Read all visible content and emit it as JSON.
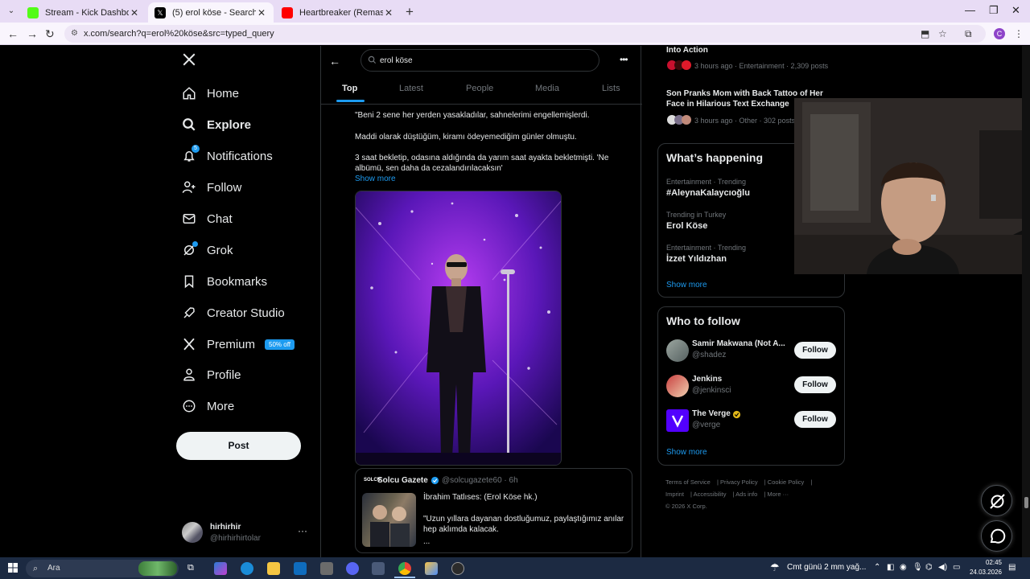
{
  "browser": {
    "tabs": [
      {
        "title": "Stream - Kick Dashboard",
        "favicon_color": "#53fc18",
        "active": false
      },
      {
        "title": "(5) erol köse - Search / X",
        "favicon_color": "#000000",
        "active": true
      },
      {
        "title": "Heartbreaker (Remastered) - Yo",
        "favicon_color": "#ff0000",
        "active": false
      }
    ],
    "url": "x.com/search?q=erol%20köse&src=typed_query",
    "profile_initial": "C"
  },
  "sidebar": {
    "items": [
      {
        "label": "Home",
        "icon": "home-icon"
      },
      {
        "label": "Explore",
        "icon": "search-icon",
        "active": true
      },
      {
        "label": "Notifications",
        "icon": "bell-icon",
        "badge": "5"
      },
      {
        "label": "Follow",
        "icon": "person-add-icon"
      },
      {
        "label": "Chat",
        "icon": "mail-icon"
      },
      {
        "label": "Grok",
        "icon": "grok-icon"
      },
      {
        "label": "Bookmarks",
        "icon": "bookmark-icon"
      },
      {
        "label": "Creator Studio",
        "icon": "rocket-icon"
      },
      {
        "label": "Premium",
        "icon": "x-icon",
        "badge": "50% off"
      },
      {
        "label": "Profile",
        "icon": "person-icon"
      },
      {
        "label": "More",
        "icon": "more-circle-icon"
      }
    ],
    "post_label": "Post",
    "account": {
      "name": "hirhirhir",
      "handle": "@hirhirhirtolar"
    }
  },
  "search": {
    "query": "erol köse",
    "tabs": [
      "Top",
      "Latest",
      "People",
      "Media",
      "Lists"
    ]
  },
  "tweet": {
    "lines": [
      "\"Beni 2 sene her yerden yasakladılar, sahnelerimi engellemişlerdi.",
      "Maddi olarak düştüğüm, kiramı ödeyemediğim günler olmuştu.",
      "3 saat bekletip, odasına aldığında da yarım saat ayakta bekletmişti. 'Ne albümü, sen daha da cezalandırılacaksın'"
    ],
    "show_more": "Show more"
  },
  "quote": {
    "logo": "SOLCU",
    "name": "Solcu Gazete",
    "handle": "@solcugazete60 · 6h",
    "lines": [
      "İbrahim Tatlıses: (Erol Köse hk.)",
      "\"Uzun yıllara dayanan dostluğumuz, paylaştığımız anılar hep aklımda kalacak.",
      "..."
    ]
  },
  "right": {
    "trends_top": [
      {
        "title": "Into Action",
        "meta": ""
      },
      {
        "title": "",
        "meta": "3 hours ago · Entertainment · 2,309 posts"
      },
      {
        "title": "Son Pranks Mom with Back Tattoo of Her Face in Hilarious Text Exchange",
        "meta": "3 hours ago · Other · 302 posts"
      }
    ],
    "whats_happening": {
      "title": "What’s happening",
      "trends": [
        {
          "category": "Entertainment · Trending",
          "name": "#AleynaKalaycıoğlu"
        },
        {
          "category": "Trending in Turkey",
          "name": "Erol Köse"
        },
        {
          "category": "Entertainment · Trending",
          "name": "İzzet Yıldızhan"
        }
      ],
      "show_more": "Show more"
    },
    "who_to_follow": {
      "title": "Who to follow",
      "accounts": [
        {
          "name": "Samir Makwana (Not A...",
          "handle": "@shadez",
          "button": "Follow"
        },
        {
          "name": "Jenkins",
          "handle": "@jenkinsci",
          "button": "Follow"
        },
        {
          "name": "The Verge",
          "handle": "@verge",
          "button": "Follow"
        }
      ],
      "show_more": "Show more"
    },
    "footer": [
      "Terms of Service",
      "Privacy Policy",
      "Cookie Policy",
      "Imprint",
      "Accessibility",
      "Ads info",
      "More ···",
      "© 2026 X Corp."
    ]
  },
  "taskbar": {
    "search_placeholder": "Ara",
    "weather": "Cmt günü 2 mm yağ...",
    "time": "02:45",
    "date": "24.03.2026"
  }
}
